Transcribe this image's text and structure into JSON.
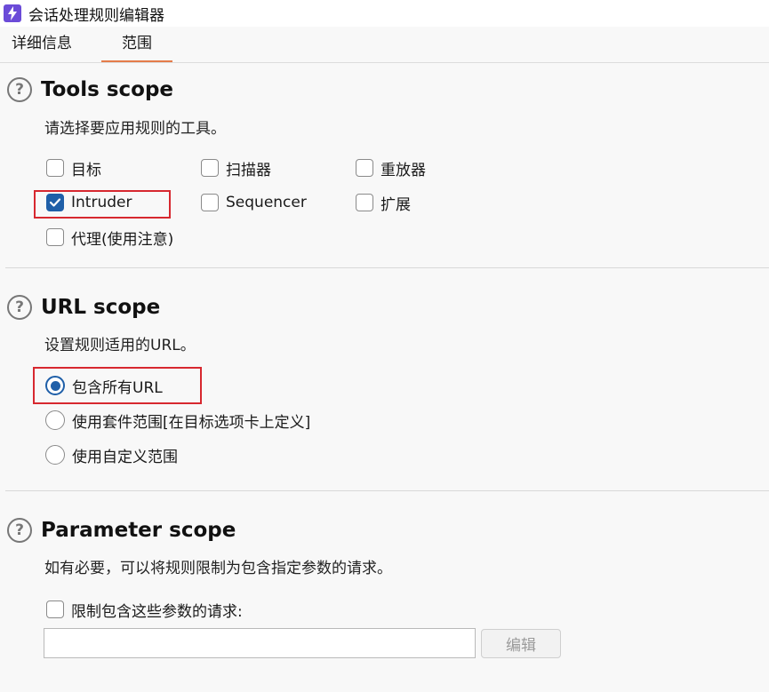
{
  "window": {
    "title": "会话处理规则编辑器"
  },
  "tabs": [
    {
      "label": "详细信息",
      "active": false
    },
    {
      "label": "范围",
      "active": true
    }
  ],
  "tools_scope": {
    "title": "Tools scope",
    "description": "请选择要应用规则的工具。",
    "options": [
      {
        "label": "目标",
        "checked": false
      },
      {
        "label": "扫描器",
        "checked": false
      },
      {
        "label": "重放器",
        "checked": false
      },
      {
        "label": "Intruder",
        "checked": true
      },
      {
        "label": "Sequencer",
        "checked": false
      },
      {
        "label": "扩展",
        "checked": false
      },
      {
        "label": "代理(使用注意)",
        "checked": false
      }
    ]
  },
  "url_scope": {
    "title": "URL scope",
    "description": "设置规则适用的URL。",
    "options": [
      {
        "label": "包含所有URL",
        "selected": true
      },
      {
        "label": "使用套件范围[在目标选项卡上定义]",
        "selected": false
      },
      {
        "label": "使用自定义范围",
        "selected": false
      }
    ]
  },
  "parameter_scope": {
    "title": "Parameter scope",
    "description": "如有必要，可以将规则限制为包含指定参数的请求。",
    "restrict_label": "限制包含这些参数的请求:",
    "restrict_checked": false,
    "input_value": "",
    "edit_label": "编辑"
  },
  "colors": {
    "accent": "#1f5fa8",
    "highlight": "#d7282f",
    "tab_underline": "#e57c4a",
    "app_icon": "#6b4bd8"
  }
}
